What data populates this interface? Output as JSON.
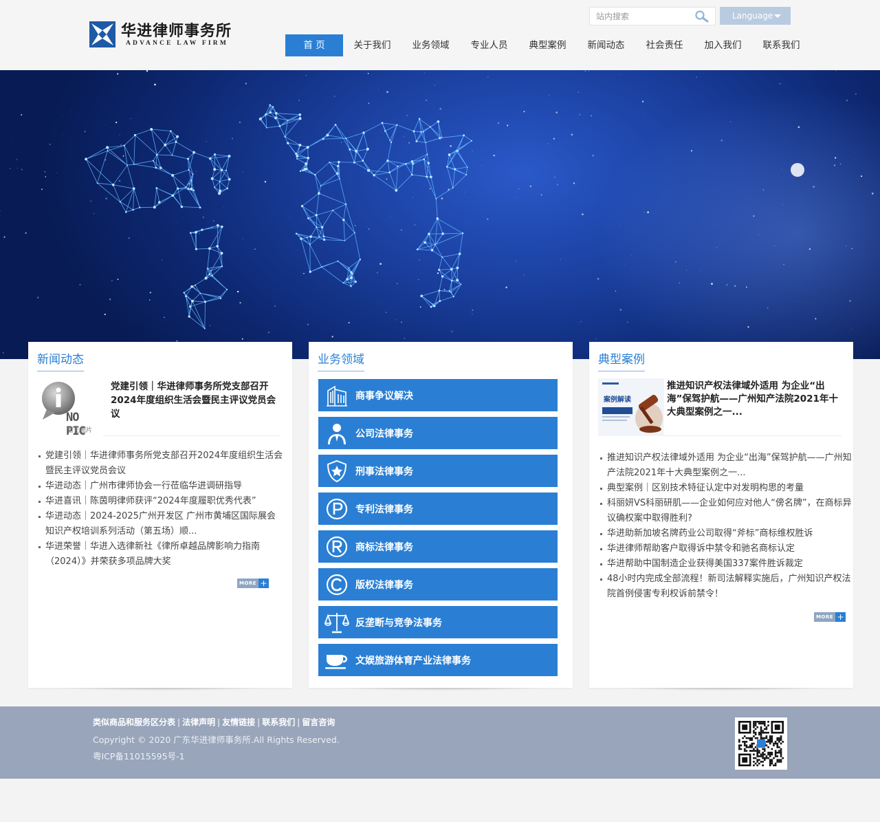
{
  "brand": {
    "name_cn": "华进律师事务所",
    "name_en": "ADVANCE LAW FIRM",
    "color": "#1f5aa6"
  },
  "search": {
    "placeholder": "站内搜索",
    "icon": "search-icon"
  },
  "language": {
    "label": "Language"
  },
  "nav": {
    "items": [
      {
        "label": "首 页",
        "active": true
      },
      {
        "label": "关于我们"
      },
      {
        "label": "业务领域"
      },
      {
        "label": "专业人员"
      },
      {
        "label": "典型案例"
      },
      {
        "label": "新闻动态"
      },
      {
        "label": "社会责任"
      },
      {
        "label": "加入我们"
      },
      {
        "label": "联系我们"
      }
    ]
  },
  "news": {
    "title": "新闻动态",
    "feature": {
      "image_text_main": "NO PIC",
      "image_text_sub": "暂无图片",
      "title": "党建引领｜华进律师事务所党支部召开2024年度组织生活会暨民主评议党员会议"
    },
    "items": [
      "党建引领｜华进律师事务所党支部召开2024年度组织生活会暨民主评议党员会议",
      "华进动态｜广州市律师协会一行莅临华进调研指导",
      "华进喜讯｜陈茵明律师获评“2024年度履职优秀代表”",
      "华进动态｜2024-2025广州开发区 广州市黄埔区国际展会知识产权培训系列活动（第五场）顺...",
      "华进荣誉｜华进入选律新社《律所卓越品牌影响力指南（2024）》并荣获多项品牌大奖"
    ],
    "more_label": "MORE"
  },
  "services": {
    "title": "业务领域",
    "items": [
      {
        "label": "商事争议解决",
        "icon": "building-icon"
      },
      {
        "label": "公司法律事务",
        "icon": "person-icon"
      },
      {
        "label": "刑事法律事务",
        "icon": "shield-star-icon"
      },
      {
        "label": "专利法律事务",
        "icon": "patent-icon"
      },
      {
        "label": "商标法律事务",
        "icon": "registered-icon"
      },
      {
        "label": "版权法律事务",
        "icon": "copyright-icon"
      },
      {
        "label": "反垄断与竞争法事务",
        "icon": "scales-icon"
      },
      {
        "label": "文娱旅游体育产业法律事务",
        "icon": "cup-icon"
      }
    ]
  },
  "cases": {
    "title": "典型案例",
    "feature": {
      "image_caption": "案例解读",
      "title": "推进知识产权法律域外适用 为企业“出海”保驾护航——广州知产法院2021年十大典型案例之一..."
    },
    "items": [
      "推进知识产权法律域外适用 为企业“出海”保驾护航——广州知产法院2021年十大典型案例之一...",
      "典型案例｜区别技术特征认定中对发明构思的考量",
      "科丽妍VS科丽研肌——企业如何应对他人“傍名牌”，在商标异议确权案中取得胜利?",
      "华进助新加坡名牌药业公司取得“斧标”商标维权胜诉",
      "华进律师帮助客户取得诉中禁令和驰名商标认定",
      "华进帮助中国制造企业获得美国337案件胜诉裁定",
      "48小时内完成全部流程！新司法解释实施后，广州知识产权法院首例侵害专利权诉前禁令！"
    ],
    "more_label": "MORE"
  },
  "footer": {
    "links": [
      "类似商品和服务区分表",
      "法律声明",
      "友情链接",
      "联系我们",
      "留言咨询"
    ],
    "copyright": "Copyright © 2020 广东华进律师事务所.All Rights Reserved.",
    "icp": "粤ICP备11015595号-1"
  },
  "colors": {
    "accent": "#2a7fd4",
    "footer_bg": "#98a5ba",
    "banner_dark": "#0d2770"
  }
}
